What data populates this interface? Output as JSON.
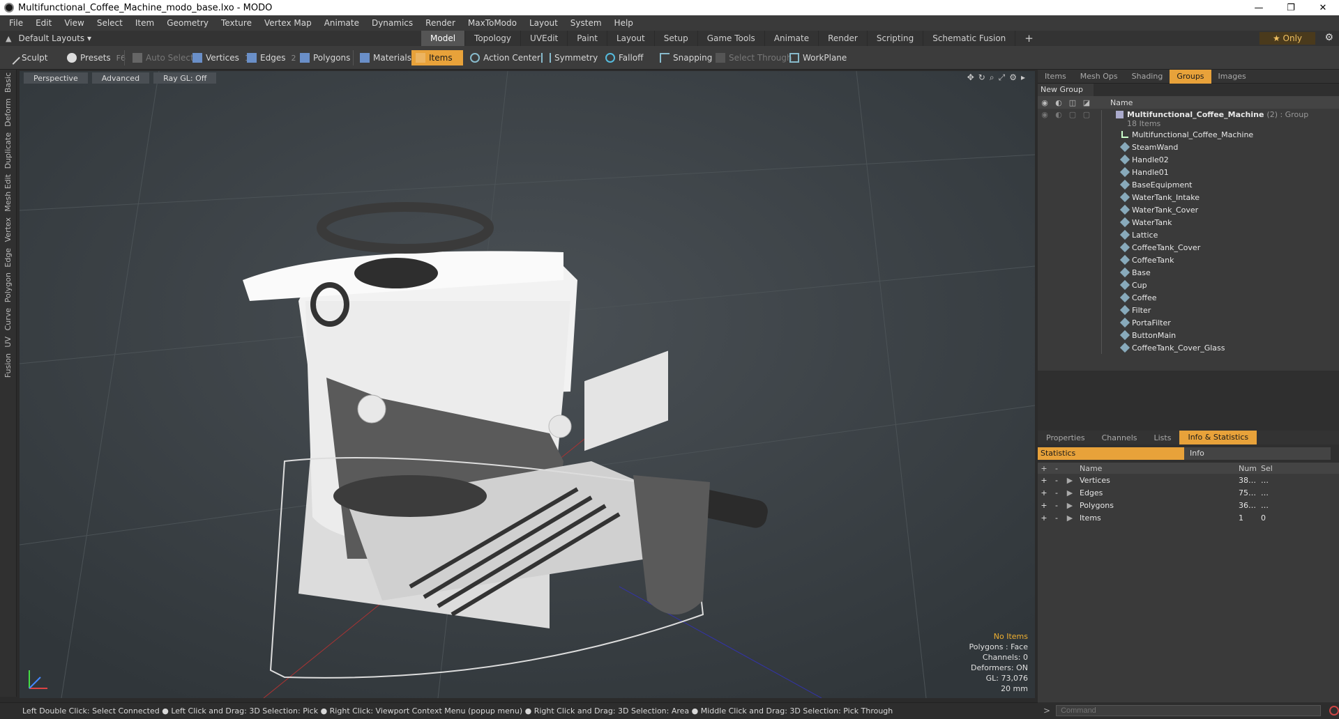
{
  "window": {
    "title": "Multifunctional_Coffee_Machine_modo_base.lxo - MODO",
    "min": "—",
    "max": "❐",
    "close": "✕"
  },
  "menu": [
    "File",
    "Edit",
    "View",
    "Select",
    "Item",
    "Geometry",
    "Texture",
    "Vertex Map",
    "Animate",
    "Dynamics",
    "Render",
    "MaxToModo",
    "Layout",
    "System",
    "Help"
  ],
  "layout": {
    "name": "Default Layouts ▾",
    "tabs": [
      "Model",
      "Topology",
      "UVEdit",
      "Paint",
      "Layout",
      "Setup",
      "Game Tools",
      "Animate",
      "Render",
      "Scripting",
      "Schematic Fusion"
    ],
    "active": "Model",
    "plus": "+",
    "only": "★  Only",
    "gear": "⚙"
  },
  "toolbar": {
    "sculpt": "Sculpt",
    "presets": "Presets",
    "presets_key": "F6",
    "auto_select": "Auto Select",
    "vertices": "Vertices",
    "vertices_num": "1",
    "edges": "Edges",
    "edges_num": "2",
    "polygons": "Polygons",
    "materials": "Materials",
    "items": "Items",
    "action_center": "Action Center",
    "symmetry": "Symmetry",
    "falloff": "Falloff",
    "snapping": "Snapping",
    "select_through": "Select Through",
    "workplane": "WorkPlane"
  },
  "left_tabs": [
    "Basic",
    "Deform",
    "Duplicate",
    "Mesh Edit",
    "Vertex",
    "Edge",
    "Polygon",
    "Curve",
    "UV",
    "Fusion"
  ],
  "viewport": {
    "perspective": "Perspective",
    "advanced": "Advanced",
    "raygl": "Ray GL: Off",
    "hud": {
      "no_items": "No Items",
      "polygons": "Polygons : Face",
      "channels": "Channels: 0",
      "deformers": "Deformers: ON",
      "gl": "GL: 73,076",
      "scale": "20 mm"
    }
  },
  "items_panel": {
    "tabs": [
      "Items",
      "Mesh Ops",
      "Shading",
      "Groups",
      "Images"
    ],
    "active": "Groups",
    "new_group": "New Group",
    "name_header": "Name",
    "group_name": "Multifunctional_Coffee_Machine",
    "group_suffix": "(2) : Group",
    "group_count": "18 Items",
    "locator": "Multifunctional_Coffee_Machine",
    "meshes": [
      "SteamWand",
      "Handle02",
      "Handle01",
      "BaseEquipment",
      "WaterTank_Intake",
      "WaterTank_Cover",
      "WaterTank",
      "Lattice",
      "CoffeeTank_Cover",
      "CoffeeTank",
      "Base",
      "Cup",
      "Coffee",
      "Filter",
      "PortaFilter",
      "ButtonMain",
      "CoffeeTank_Cover_Glass"
    ]
  },
  "stats_panel": {
    "tabs": [
      "Properties",
      "Channels",
      "Lists",
      "Info & Statistics"
    ],
    "active": "Info & Statistics",
    "statistics": "Statistics",
    "info": "Info",
    "headers": {
      "name": "Name",
      "num": "Num",
      "sel": "Sel"
    },
    "rows": [
      {
        "name": "Vertices",
        "num": "38…",
        "sel": "…"
      },
      {
        "name": "Edges",
        "num": "75…",
        "sel": "…"
      },
      {
        "name": "Polygons",
        "num": "36…",
        "sel": "…"
      },
      {
        "name": "Items",
        "num": "1",
        "sel": "0"
      }
    ]
  },
  "status": "Left Double Click: Select Connected ● Left Click and Drag: 3D Selection: Pick ● Right Click: Viewport Context Menu (popup menu) ● Right Click and Drag: 3D Selection: Area ● Middle Click and Drag: 3D Selection: Pick Through",
  "command": {
    "placeholder": "Command",
    "arrow": ">"
  }
}
